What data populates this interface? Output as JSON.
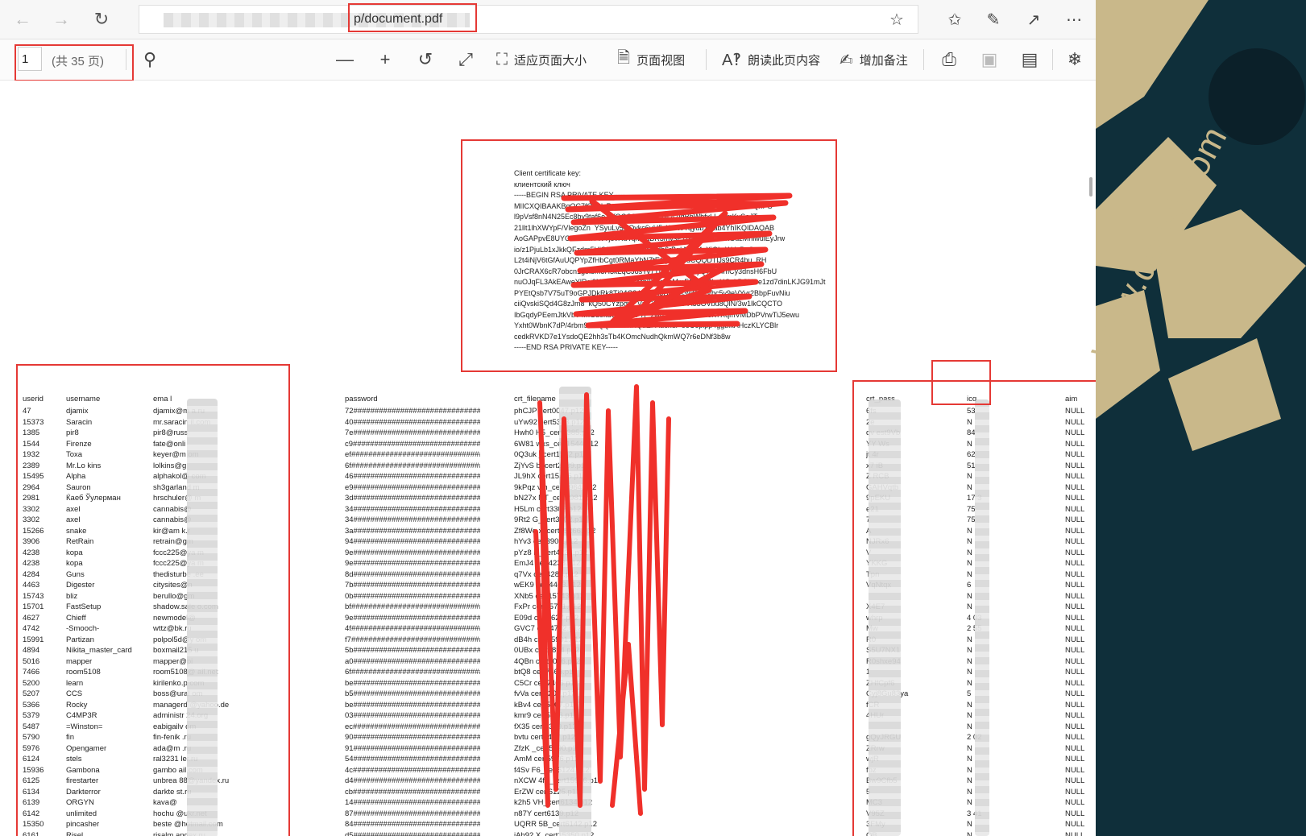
{
  "browser": {
    "url_text": "p/document.pdf",
    "icons": [
      "back-arrow-icon",
      "forward-arrow-icon",
      "refresh-icon",
      "star-icon",
      "favorites-icon",
      "pen-icon",
      "share-icon",
      "more-icon"
    ]
  },
  "toolbar": {
    "page_number": "1",
    "page_total": "(共 35 页)",
    "fit_page": "适应页面大小",
    "page_view": "页面视图",
    "read_aloud": "朗读此页内容",
    "add_notes": "增加备注"
  },
  "certificate": {
    "lines": [
      "Client certificate key:",
      "клиентский ключ",
      "-----BEGIN RSA PRIVATE KEY-----",
      "MIICXQIBAAKBgQC7fOmdzRxmyhoI9bXm4vE3EbSnCa9Qf2A7jaeqdGx1QhPS",
      "l9pVsf8nN4N25Ec8by9taf6e1gfOGSJm2X/m5Nc47lqBbWhfxLLe  mKvSeJTm",
      "21llt1lhXWYpF/VlegoZn  YSyuLv5NOykc6uH5zW3WYqyub1Qab4YhIKQIDAQAB",
      "AoGAPpvE8UYORwk7nYWTj5vRdYqMaaBR3mvsP7rMFnm0o0VkGuzMniwuiEyJrw",
      "io/z1PjuLb1xJkkQFzdm5HjS2GZr2N0OHNSdb6rBqkNR24cXiGkzWdyP  Gy",
      "L2t4iNjV6tGfAuUQPYpZfHbCgt0RMaYbNZtEGpVt9MdCQQDTlJs9CR4bu  RH",
      "0JrCRAX6cR7obcn1gtx8m5H3kLqCJ8sYv7TfdAKkP4VPyQ7ysf4mCy3dnsH6FbU",
      "nuOJqFL3AkEAweYlRsj2Nxh7d5QrgsMp8hVcKbMmF18AACkpHCpkPOYwe1zd7dinLKJG91mJt",
      "PYEtQsb7V75uT9oGPJDkRk8Tj04C24RV3wJBAI2n3wDA0Vbc5y9eVYvr2BbpFuvNiu",
      "ciiQvskiSQd4G8zJm8  kQ50CYzpgyf  VnjCQiFrIRSE  A53OVbu8QlN/3w1lkCQCTO",
      "IbGqdyPEemJtkVbT4mGd0kdU1s8c3F7r  zwRJ9Ck0hN3nEeK7XqmVMDbPVrwTiJ5ewu",
      "Yxht0WbnK7dP/4rbm9ECQQCAvYxRQdEPAucndl  eeC6pipp4ggblkAHczKLYCBlr",
      "cedkRVKD7e1YsdoQE2hh3sTb4KOmcNudhQkmWQ7r6eDNf3b8w",
      "-----END RSA PRIVATE KEY-----"
    ]
  },
  "table": {
    "headers": {
      "userid": "userid",
      "username": "username",
      "email": "ema l",
      "password": "password",
      "crt_filename": "crt_filename",
      "crt_pass": "crt_pass",
      "icq": "icq",
      "aim": "aim"
    },
    "userids": [
      "47",
      "15373",
      "1385",
      "1544",
      "1932",
      "2389",
      "15495",
      "2964",
      "2981",
      "3302",
      "3302",
      "15266",
      "3906",
      "4238",
      "4238",
      "4284",
      "4463",
      "15743",
      "15701",
      "4627",
      "4742",
      "15991",
      "4894",
      "5016",
      "7466",
      "5200",
      "5207",
      "5366",
      "5379",
      "5487",
      "5790",
      "5976",
      "6124",
      "15936",
      "6125",
      "6134",
      "6139",
      "6142",
      "15350",
      "6161"
    ],
    "usernames": [
      "djamix",
      "Saracin",
      "pir8",
      "Firenze",
      "Toxa",
      "Mr.Lo kins",
      "Alpha",
      "Sauron",
      "Ќаеб Ўулерман",
      "axel",
      "axel",
      "snake",
      "RetRain",
      "kopa",
      "kopa",
      "Guns",
      "Digester",
      "bliz",
      "FastSetup",
      "Chieff",
      "-Smooch-",
      "Partizan",
      "Nikita_master_card",
      "mapper",
      "room5108",
      "learn",
      "CCS",
      "Rocky",
      "C4MP3R",
      "=Winston=",
      "fin",
      "Opengamer",
      "stels",
      "Gambona",
      "firestarter",
      "Darkterror",
      "ORGYN",
      "unlimited",
      "pincasher",
      "Risel"
    ],
    "emails": [
      "djamix@m     a.ru",
      "mr.saracin      il.com",
      "pir8@russ",
      "fate@onli",
      "keyer@m       om",
      "lolkins@g",
      "alphakol@       com",
      "sh3garland      m",
      "hrschuler@       m",
      "cannabis@",
      "cannabis@",
      "kir@am k.r",
      "retrain@gm",
      "fccc225@ya       m",
      "fccc225@ya       m",
      "thedisturbe       .ee",
      "citysites@n",
      "berullo@gm",
      "shadow.sale       o.com",
      "newmodel@",
      "wttz@bk.ru",
      "polpol5d@y       om",
      "boxmail215      u",
      "mapper@pi",
      "room5108@       ail.net",
      "kirilenko.p       com",
      "boss@ural       om",
      "managerd       @yahoo.de",
      "administr       24.org",
      "eabigailv       om",
      "fin-fenik       .ru",
      "ada@m       .ru",
      "ral3231       ler.ru",
      "gambo       ail.com",
      "unbrea       88@yandex.ru",
      "darkte       st.ru",
      "kava@",
      "hochu       @ukr.net",
      "beste       @hotmail.com",
      "risalm       andex.ru"
    ],
    "password_fill": "################################",
    "password_prefixes": [
      "72",
      "40",
      "7e",
      "c9",
      "ef",
      "6f",
      "46",
      "e9",
      "3d",
      "34",
      "34",
      "3a",
      "94",
      "9e",
      "9e",
      "8d",
      "7b",
      "0b",
      "bf",
      "9e",
      "4f",
      "f7",
      "5b",
      "a0",
      "6f",
      "be",
      "b5",
      "be",
      "03",
      "ec",
      "90",
      "91",
      "54",
      "4c",
      "d4",
      "cb",
      "14",
      "87",
      "84",
      "d5"
    ],
    "crt_files": [
      "phCJP    cert0047.p12",
      "uYw92    cert5373.p12",
      "Hwh0    H5_cert1385.p12",
      "6W81    wxs_cert1544.p12",
      "0Q3uk    _cert1932.p12",
      "ZjYvS    b_cert2389.p12",
      "JL9hX    cert15495.p12",
      "9kPqz    vm_cert2964.p12",
      "bN27x    NT_cert2981.p12",
      "H5Lm    cert3302.p12",
      "9Rt2    G_cert3302.p12",
      "Zf8Wq    x_cert15266.p12",
      "hYv3    cert3906.p12",
      "pYz8    K_cert4238.p12",
      "EmJ4    cert4238.p12",
      "q7Vx    cert4284.p12",
      "wEK9    cert4463.p12",
      "XNb5    cert15743.p12",
      "FxPr    cert15701.p12",
      "E09d    cert4627.p12",
      "GVC7    cert4742.p12",
      "dB4h    cert15991.p12",
      "0UBx    cert4894.p12",
      "4QBn    cert5016.p12",
      "btQ8    cert7466.p12",
      "C5Cr    cert7466.p12",
      "fvVa    cert5200.p12",
      "kBv4    cert5207.p12",
      "kmr9    cert5366.p12",
      "fX35    cert5379.p12",
      "bvtu    cert5487.p12",
      "ZfzK    _cert5790.p12",
      "AmM    cert5976.p12",
      "f4Sv    F6_cert6124.p12",
      "nXCW    4f1_cert15936.p12",
      "ErZW    cert6125.p12",
      "k2h5    VH_cert6134.p12",
      "n87Y    cert6139.p12",
      "UQRR    5B_cert6142.p12",
      "jAh92    X_cert15350.p12"
    ],
    "crt_pass": [
      "6fs",
      "2e",
      "qv     est9Vb",
      "YY     Ws",
      "jt     4r",
      "x7     iB",
      "Z     RCB",
      "     GAHVqtb",
      "     9pEKU",
      "     e21",
      "     7",
      "     A",
      "     NJRx6",
      "     V",
      "     YKKG",
      "     Tpn",
      "     VqNtqx",
      "     ",
      "     X4E7",
      "     whrp",
      "     Mw",
      "     R0",
      "     S5U7NX1",
      "     R0shxe94",
      "     1",
      "     ZHfCpf6",
      "     Cyj8Gu83ya",
      "     fCR",
      "     4HUr",
      "     ",
      "     gQyJRGU",
      "     ZRrw",
      "     wjR",
      "     fbz",
      "     Bw9Cfb5",
      "     5",
      "     MC3",
      "     V95Z",
      "     3FMy",
      "OB"
    ],
    "icq": [
      "53",
      "N",
      "84",
      "N",
      "62",
      "51",
      "N",
      "N",
      "17     3",
      "75",
      "75",
      "N",
      "N",
      "N",
      "N",
      "N",
      "6",
      "N",
      "N",
      "4     03",
      "2     55",
      "N",
      "N",
      "N",
      "N",
      "N",
      "5",
      "N",
      "N",
      "N",
      "2     02",
      "N",
      "N",
      "N",
      "N",
      "N",
      "N",
      "3     41",
      "N",
      "N"
    ],
    "aim_value": "NULL"
  },
  "watermark": {
    "text": "www.ddosi.com"
  }
}
